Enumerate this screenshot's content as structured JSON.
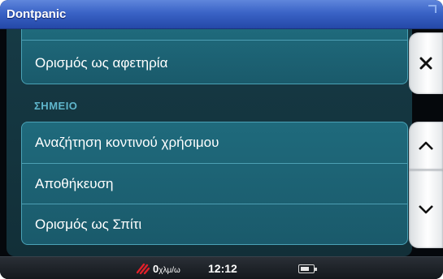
{
  "window": {
    "title": "Dontpanic"
  },
  "menu": {
    "top_item": {
      "label": "Ορισμός ως αφετηρία"
    },
    "section_label": "ΣΗΜΕΙΟ",
    "items": [
      {
        "label": "Αναζήτηση κοντινού χρήσιμου"
      },
      {
        "label": "Αποθήκευση"
      },
      {
        "label": "Ορισμός ως  Σπίτι"
      }
    ]
  },
  "side_buttons": {
    "close_icon": "close-x-icon",
    "up_icon": "chevron-up-icon",
    "down_icon": "chevron-down-icon"
  },
  "status": {
    "speed_value": "0",
    "speed_unit": "χλμ/ω",
    "time": "12:12",
    "battery_level": 0.7,
    "speed_icon": "speed-icon",
    "battery_icon": "battery-icon"
  },
  "colors": {
    "titlebar": "#3a63c6",
    "item_background": "#1f6a7c",
    "section_label": "#5fb6cc",
    "speed_icon": "#e0202a"
  }
}
